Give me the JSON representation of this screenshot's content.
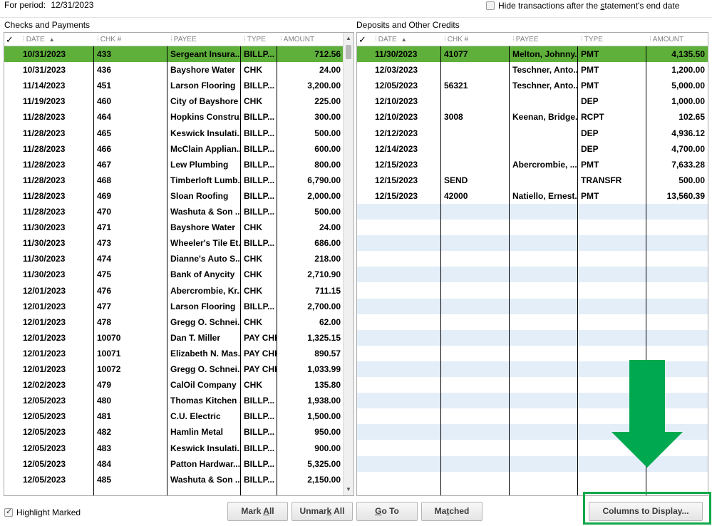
{
  "header": {
    "period_label": "For period:",
    "period_value": "12/31/2023",
    "hide_option_prefix": "Hide transactions after the ",
    "hide_option_underlined": "s",
    "hide_option_suffix": "tatement's end date",
    "hide_checked": false
  },
  "checks": {
    "title": "Checks and Payments",
    "columns": {
      "check": "✓",
      "date": "DATE",
      "chk": "CHK #",
      "payee": "PAYEE",
      "type": "TYPE",
      "amount": "AMOUNT"
    },
    "rows": [
      {
        "date": "10/31/2023",
        "chk": "433",
        "payee": "Sergeant Insura...",
        "type": "BILLP...",
        "amount": "712.56"
      },
      {
        "date": "10/31/2023",
        "chk": "436",
        "payee": "Bayshore Water",
        "type": "CHK",
        "amount": "24.00"
      },
      {
        "date": "11/14/2023",
        "chk": "451",
        "payee": "Larson Flooring",
        "type": "BILLP...",
        "amount": "3,200.00"
      },
      {
        "date": "11/19/2023",
        "chk": "460",
        "payee": "City of Bayshore",
        "type": "CHK",
        "amount": "225.00"
      },
      {
        "date": "11/28/2023",
        "chk": "464",
        "payee": "Hopkins Constru...",
        "type": "BILLP...",
        "amount": "300.00"
      },
      {
        "date": "11/28/2023",
        "chk": "465",
        "payee": "Keswick Insulati...",
        "type": "BILLP...",
        "amount": "500.00"
      },
      {
        "date": "11/28/2023",
        "chk": "466",
        "payee": "McClain Applian...",
        "type": "BILLP...",
        "amount": "600.00"
      },
      {
        "date": "11/28/2023",
        "chk": "467",
        "payee": "Lew Plumbing",
        "type": "BILLP...",
        "amount": "800.00"
      },
      {
        "date": "11/28/2023",
        "chk": "468",
        "payee": "Timberloft Lumb...",
        "type": "BILLP...",
        "amount": "6,790.00"
      },
      {
        "date": "11/28/2023",
        "chk": "469",
        "payee": "Sloan Roofing",
        "type": "BILLP...",
        "amount": "2,000.00"
      },
      {
        "date": "11/28/2023",
        "chk": "470",
        "payee": "Washuta & Son ...",
        "type": "BILLP...",
        "amount": "500.00"
      },
      {
        "date": "11/30/2023",
        "chk": "471",
        "payee": "Bayshore Water",
        "type": "CHK",
        "amount": "24.00"
      },
      {
        "date": "11/30/2023",
        "chk": "473",
        "payee": "Wheeler's Tile Et...",
        "type": "BILLP...",
        "amount": "686.00"
      },
      {
        "date": "11/30/2023",
        "chk": "474",
        "payee": "Dianne's Auto S...",
        "type": "CHK",
        "amount": "218.00"
      },
      {
        "date": "11/30/2023",
        "chk": "475",
        "payee": "Bank of Anycity",
        "type": "CHK",
        "amount": "2,710.90"
      },
      {
        "date": "12/01/2023",
        "chk": "476",
        "payee": "Abercrombie, Kr...",
        "type": "CHK",
        "amount": "711.15"
      },
      {
        "date": "12/01/2023",
        "chk": "477",
        "payee": "Larson Flooring",
        "type": "BILLP...",
        "amount": "2,700.00"
      },
      {
        "date": "12/01/2023",
        "chk": "478",
        "payee": "Gregg O. Schnei...",
        "type": "CHK",
        "amount": "62.00"
      },
      {
        "date": "12/01/2023",
        "chk": "10070",
        "payee": "Dan T. Miller",
        "type": "PAY CHK",
        "amount": "1,325.15"
      },
      {
        "date": "12/01/2023",
        "chk": "10071",
        "payee": "Elizabeth N. Mas...",
        "type": "PAY CHK",
        "amount": "890.57"
      },
      {
        "date": "12/01/2023",
        "chk": "10072",
        "payee": "Gregg O. Schnei...",
        "type": "PAY CHK",
        "amount": "1,033.99"
      },
      {
        "date": "12/02/2023",
        "chk": "479",
        "payee": "CalOil Company",
        "type": "CHK",
        "amount": "135.80"
      },
      {
        "date": "12/05/2023",
        "chk": "480",
        "payee": "Thomas Kitchen ...",
        "type": "BILLP...",
        "amount": "1,938.00"
      },
      {
        "date": "12/05/2023",
        "chk": "481",
        "payee": "C.U. Electric",
        "type": "BILLP...",
        "amount": "1,500.00"
      },
      {
        "date": "12/05/2023",
        "chk": "482",
        "payee": "Hamlin Metal",
        "type": "BILLP...",
        "amount": "950.00"
      },
      {
        "date": "12/05/2023",
        "chk": "483",
        "payee": "Keswick Insulati...",
        "type": "BILLP...",
        "amount": "900.00"
      },
      {
        "date": "12/05/2023",
        "chk": "484",
        "payee": "Patton Hardwar...",
        "type": "BILLP...",
        "amount": "5,325.00"
      },
      {
        "date": "12/05/2023",
        "chk": "485",
        "payee": "Washuta & Son ...",
        "type": "BILLP...",
        "amount": "2,150.00"
      }
    ]
  },
  "deposits": {
    "title": "Deposits and Other Credits",
    "columns": {
      "check": "✓",
      "date": "DATE",
      "chk": "CHK #",
      "payee": "PAYEE",
      "type": "TYPE",
      "amount": "AMOUNT"
    },
    "rows": [
      {
        "date": "11/30/2023",
        "chk": "41077",
        "payee": "Melton, Johnny...",
        "type": "PMT",
        "amount": "4,135.50"
      },
      {
        "date": "12/03/2023",
        "chk": "",
        "payee": "Teschner, Anto...",
        "type": "PMT",
        "amount": "1,200.00"
      },
      {
        "date": "12/05/2023",
        "chk": "56321",
        "payee": "Teschner, Anto...",
        "type": "PMT",
        "amount": "5,000.00"
      },
      {
        "date": "12/10/2023",
        "chk": "",
        "payee": "",
        "type": "DEP",
        "amount": "1,000.00"
      },
      {
        "date": "12/10/2023",
        "chk": "3008",
        "payee": "Keenan, Bridge...",
        "type": "RCPT",
        "amount": "102.65"
      },
      {
        "date": "12/12/2023",
        "chk": "",
        "payee": "",
        "type": "DEP",
        "amount": "4,936.12"
      },
      {
        "date": "12/14/2023",
        "chk": "",
        "payee": "",
        "type": "DEP",
        "amount": "4,700.00"
      },
      {
        "date": "12/15/2023",
        "chk": "",
        "payee": "Abercrombie, ...",
        "type": "PMT",
        "amount": "7,633.28"
      },
      {
        "date": "12/15/2023",
        "chk": "SEND",
        "payee": "",
        "type": "TRANSFR",
        "amount": "500.00"
      },
      {
        "date": "12/15/2023",
        "chk": "42000",
        "payee": "Natiello, Ernest...",
        "type": "PMT",
        "amount": "13,560.39"
      }
    ]
  },
  "footer": {
    "highlight_label": "Highlight Marked",
    "highlight_checked": true,
    "mark_all": {
      "pre": "Mark ",
      "u": "A",
      "post": "ll"
    },
    "unmark_all": {
      "pre": "Unmar",
      "u": "k",
      "post": " All"
    },
    "go_to": {
      "pre": "",
      "u": "G",
      "post": "o To"
    },
    "matched": {
      "pre": "Ma",
      "u": "t",
      "post": "ched"
    },
    "columns_to_display": "Columns to Display..."
  },
  "colors": {
    "selected_row": "#5eb03a",
    "stripe": "#e3eef9",
    "annotation_green": "#00a84f"
  }
}
